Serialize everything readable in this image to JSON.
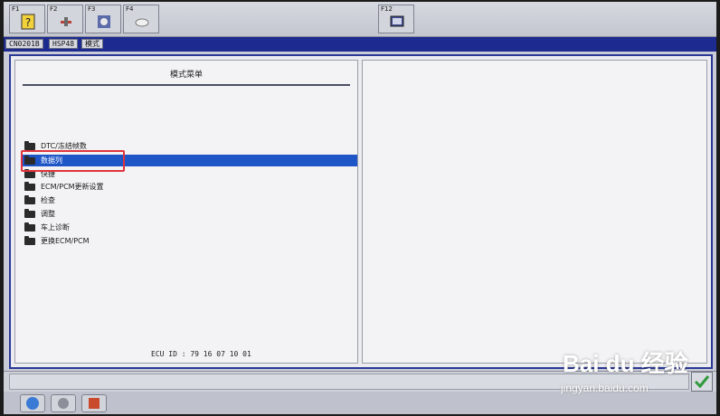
{
  "toolbar": {
    "keys": [
      {
        "label": "F1",
        "icon": "help-icon"
      },
      {
        "label": "F2",
        "icon": "tool-icon"
      },
      {
        "label": "F3",
        "icon": "vehicle-icon"
      },
      {
        "label": "F4",
        "icon": "cloud-icon"
      },
      {
        "label": "F12",
        "icon": "screen-icon"
      }
    ]
  },
  "status": {
    "chips": [
      "CN0201B",
      "HSP48",
      "模式"
    ]
  },
  "menu": {
    "title": "模式菜单",
    "items": [
      "DTC/冻结帧数",
      "数据列",
      "快捷",
      "ECM/PCM更新设置",
      "检查",
      "调整",
      "车上诊断",
      "更换ECM/PCM"
    ],
    "selected_index": 1
  },
  "ecu": {
    "id_text": "ECU ID : 79 16 07 10 01"
  },
  "watermark": {
    "brand": "Bai du 经验",
    "site": "jingyan.baidu.com"
  },
  "colors": {
    "selection": "#1e56c8",
    "frame": "#2a3896",
    "annotation": "#e0333b"
  }
}
